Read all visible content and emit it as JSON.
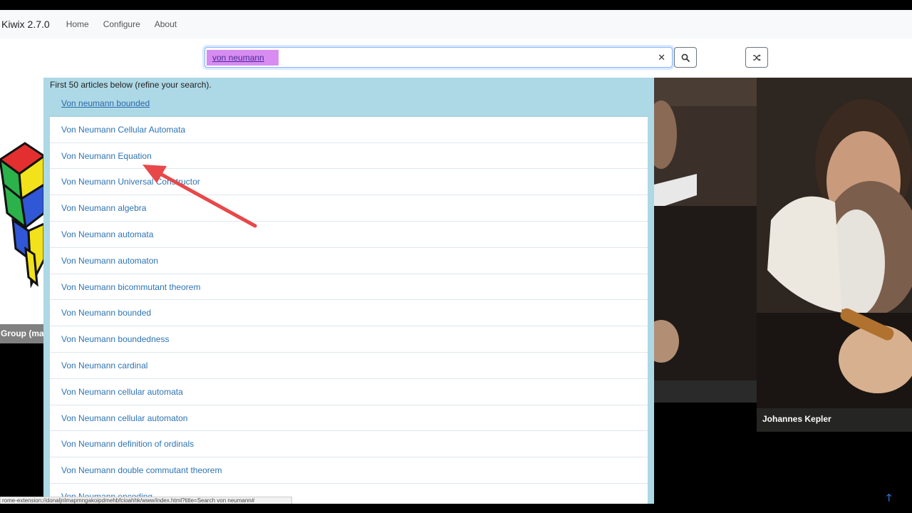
{
  "navbar": {
    "brand": "Kiwix 2.7.0",
    "links": [
      "Home",
      "Configure",
      "About"
    ]
  },
  "search": {
    "value": "von neumann",
    "clear_icon": "close-icon",
    "search_icon": "search-icon",
    "random_icon": "shuffle-icon"
  },
  "dropdown": {
    "header": "First 50 articles below (refine your search).",
    "results": [
      "Von neumann bounded",
      "Von Neumann Cellular Automata",
      "Von Neumann Equation",
      "Von Neumann Universal Constructor",
      "Von Neumann algebra",
      "Von Neumann automata",
      "Von Neumann automaton",
      "Von Neumann bicommutant theorem",
      "Von Neumann bounded",
      "Von Neumann boundedness",
      "Von Neumann cardinal",
      "Von Neumann cellular automata",
      "Von Neumann cellular automaton",
      "Von Neumann definition of ordinals",
      "Von Neumann double commutant theorem",
      "Von Neumann encoding"
    ]
  },
  "background": {
    "left_caption": "Group (mat",
    "right_caption": "Johannes Kepler"
  },
  "statusbar": {
    "url": "rome-extension://donaljnlmapmngakoipdmehbfcioahhk/www/index.html?title=Search von neumann#"
  },
  "colors": {
    "highlight": "#d88cf2",
    "dropdown_bg": "#add8e6",
    "link": "#2d74b5",
    "arrow": "#e8484a"
  }
}
